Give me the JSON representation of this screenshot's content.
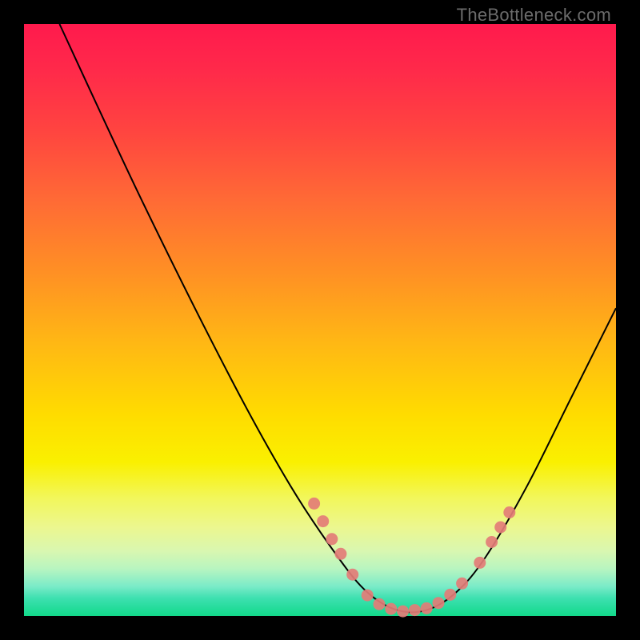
{
  "watermark": "TheBottleneck.com",
  "chart_data": {
    "type": "line",
    "title": "",
    "xlabel": "",
    "ylabel": "",
    "xlim": [
      0,
      100
    ],
    "ylim": [
      0,
      100
    ],
    "grid": false,
    "legend": false,
    "background": "heatmap-gradient",
    "series": [
      {
        "name": "bottleneck-curve",
        "path_points": [
          {
            "x": 6,
            "y": 100
          },
          {
            "x": 20,
            "y": 70
          },
          {
            "x": 35,
            "y": 40
          },
          {
            "x": 45,
            "y": 22
          },
          {
            "x": 53,
            "y": 10
          },
          {
            "x": 58,
            "y": 4
          },
          {
            "x": 63,
            "y": 1
          },
          {
            "x": 68,
            "y": 1
          },
          {
            "x": 73,
            "y": 4
          },
          {
            "x": 78,
            "y": 10
          },
          {
            "x": 85,
            "y": 22
          },
          {
            "x": 92,
            "y": 36
          },
          {
            "x": 100,
            "y": 52
          }
        ]
      }
    ],
    "markers": [
      {
        "x": 49,
        "y": 19
      },
      {
        "x": 50.5,
        "y": 16
      },
      {
        "x": 52,
        "y": 13
      },
      {
        "x": 53.5,
        "y": 10.5
      },
      {
        "x": 55.5,
        "y": 7
      },
      {
        "x": 58,
        "y": 3.5
      },
      {
        "x": 60,
        "y": 2
      },
      {
        "x": 62,
        "y": 1.2
      },
      {
        "x": 64,
        "y": 0.8
      },
      {
        "x": 66,
        "y": 1.0
      },
      {
        "x": 68,
        "y": 1.3
      },
      {
        "x": 70,
        "y": 2.2
      },
      {
        "x": 72,
        "y": 3.6
      },
      {
        "x": 74,
        "y": 5.5
      },
      {
        "x": 77,
        "y": 9
      },
      {
        "x": 79,
        "y": 12.5
      },
      {
        "x": 80.5,
        "y": 15
      },
      {
        "x": 82,
        "y": 17.5
      }
    ]
  }
}
